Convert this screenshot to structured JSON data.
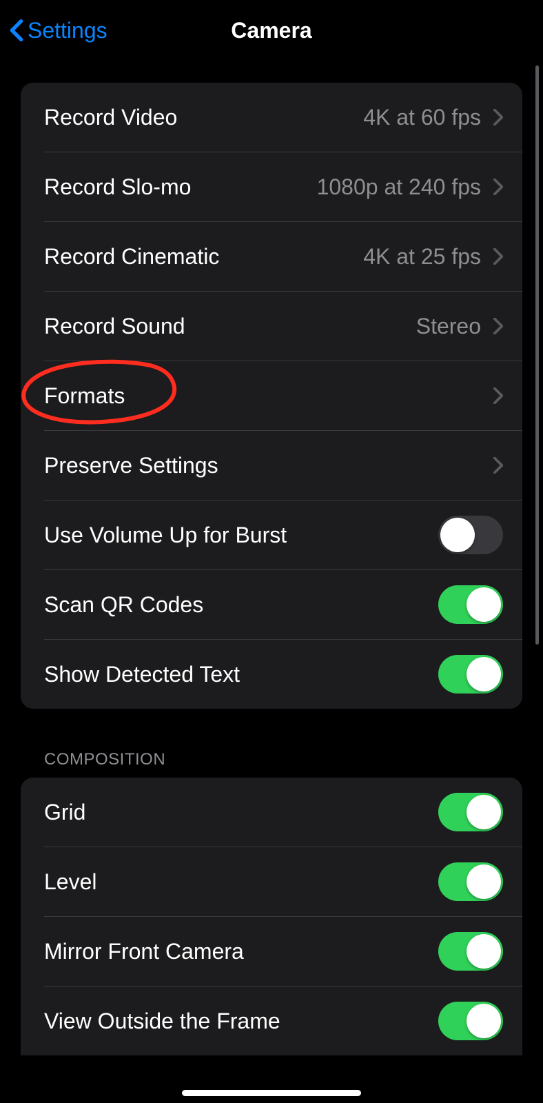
{
  "nav": {
    "back_label": "Settings",
    "title": "Camera"
  },
  "groups": [
    {
      "rows": [
        {
          "name": "record-video",
          "label": "Record Video",
          "value": "4K at 60 fps",
          "type": "link"
        },
        {
          "name": "record-slomo",
          "label": "Record Slo-mo",
          "value": "1080p at 240 fps",
          "type": "link"
        },
        {
          "name": "record-cinematic",
          "label": "Record Cinematic",
          "value": "4K at 25 fps",
          "type": "link"
        },
        {
          "name": "record-sound",
          "label": "Record Sound",
          "value": "Stereo",
          "type": "link"
        },
        {
          "name": "formats",
          "label": "Formats",
          "type": "link"
        },
        {
          "name": "preserve-settings",
          "label": "Preserve Settings",
          "type": "link"
        },
        {
          "name": "volume-up-burst",
          "label": "Use Volume Up for Burst",
          "type": "toggle",
          "on": false
        },
        {
          "name": "scan-qr",
          "label": "Scan QR Codes",
          "type": "toggle",
          "on": true
        },
        {
          "name": "show-detected-text",
          "label": "Show Detected Text",
          "type": "toggle",
          "on": true
        }
      ]
    }
  ],
  "section2": {
    "header": "COMPOSITION",
    "rows": [
      {
        "name": "grid",
        "label": "Grid",
        "type": "toggle",
        "on": true
      },
      {
        "name": "level",
        "label": "Level",
        "type": "toggle",
        "on": true
      },
      {
        "name": "mirror-front-camera",
        "label": "Mirror Front Camera",
        "type": "toggle",
        "on": true
      },
      {
        "name": "view-outside-frame",
        "label": "View Outside the Frame",
        "type": "toggle",
        "on": true
      }
    ]
  },
  "annotation": {
    "target": "formats",
    "color": "#ff2d1f"
  }
}
